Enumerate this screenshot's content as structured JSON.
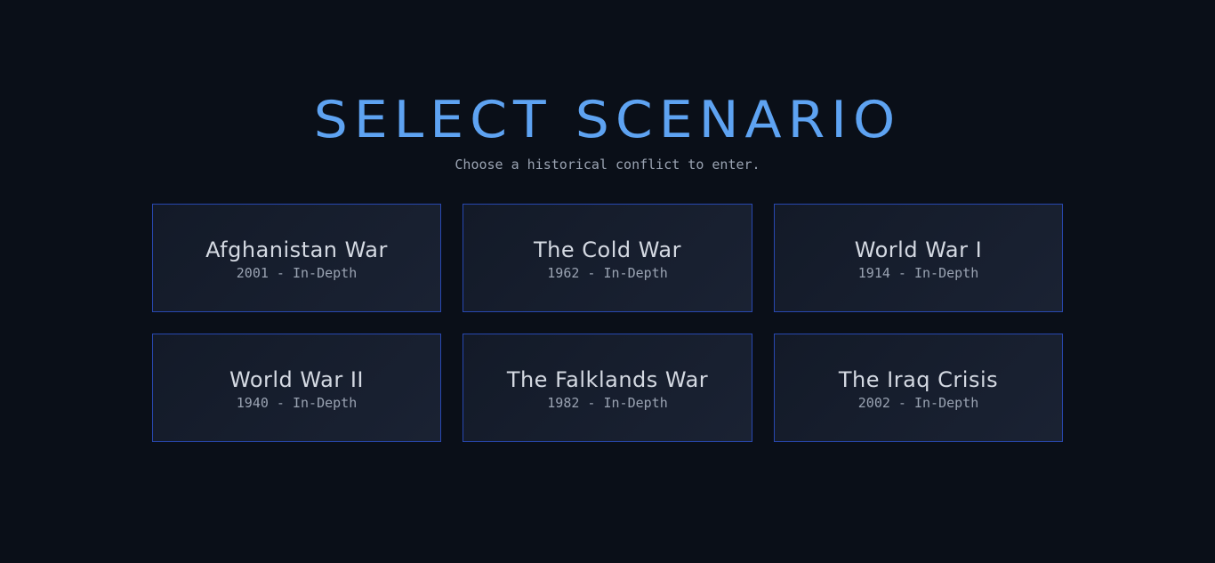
{
  "header": {
    "title": "SELECT SCENARIO",
    "subtitle": "Choose a historical conflict to enter."
  },
  "scenarios": [
    {
      "name": "Afghanistan War",
      "details": "2001 - In-Depth"
    },
    {
      "name": "The Cold War",
      "details": "1962 - In-Depth"
    },
    {
      "name": "World War I",
      "details": "1914 - In-Depth"
    },
    {
      "name": "World War II",
      "details": "1940 - In-Depth"
    },
    {
      "name": "The Falklands War",
      "details": "1982 - In-Depth"
    },
    {
      "name": "The Iraq Crisis",
      "details": "2002 - In-Depth"
    }
  ],
  "colors": {
    "background": "#0a0f18",
    "accent": "#5ea3f2",
    "card_border": "#2848b0",
    "card_text": "#d4d9e2",
    "muted_text": "#9aa3b2"
  }
}
